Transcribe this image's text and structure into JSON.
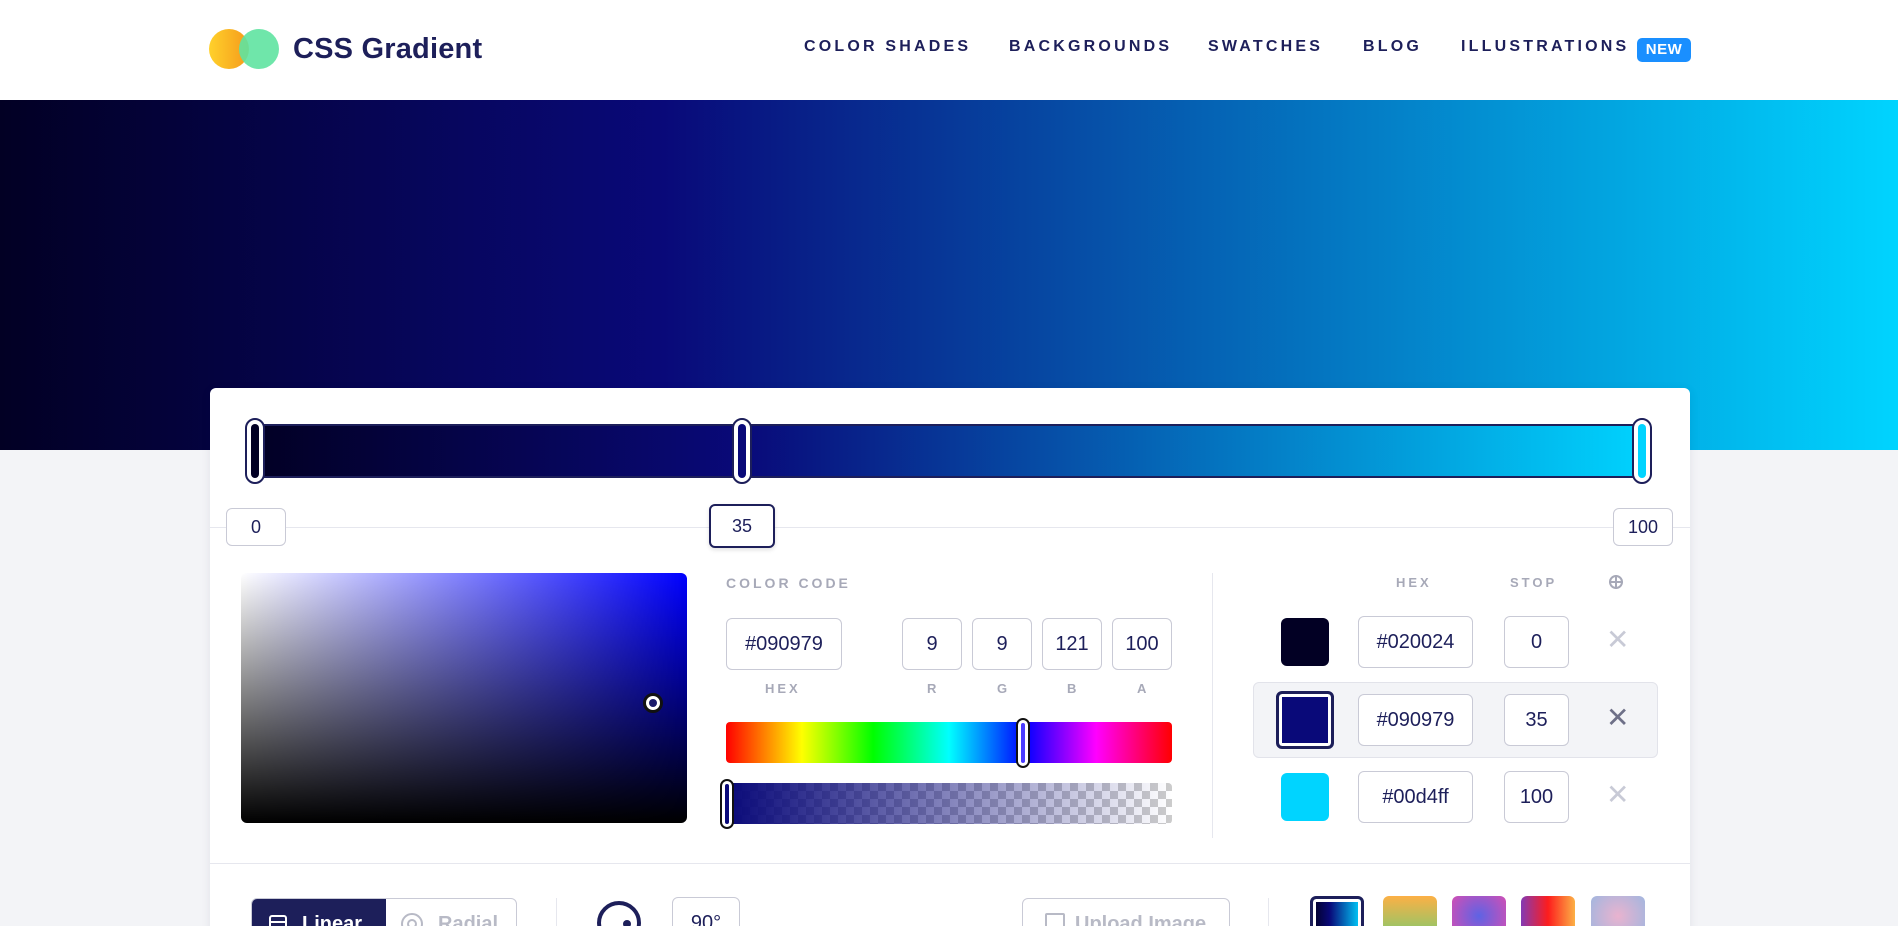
{
  "brand": {
    "name": "CSS Gradient"
  },
  "nav": [
    {
      "label": "COLOR SHADES"
    },
    {
      "label": "BACKGROUNDS"
    },
    {
      "label": "SWATCHES"
    },
    {
      "label": "BLOG"
    },
    {
      "label": "ILLUSTRATIONS",
      "badge": "NEW"
    }
  ],
  "stops_positions": [
    "0",
    "35",
    "100"
  ],
  "color_code": {
    "title": "COLOR CODE",
    "hex": "#090979",
    "r": "9",
    "g": "9",
    "b": "121",
    "a": "100",
    "labels": {
      "hex": "HEX",
      "r": "R",
      "g": "G",
      "b": "B",
      "a": "A"
    }
  },
  "stops_table": {
    "headers": {
      "hex": "HEX",
      "stop": "STOP"
    },
    "rows": [
      {
        "color": "#020024",
        "hex": "#020024",
        "stop": "0",
        "active": false
      },
      {
        "color": "#090979",
        "hex": "#090979",
        "stop": "35",
        "active": true
      },
      {
        "color": "#00d4ff",
        "hex": "#00d4ff",
        "stop": "100",
        "active": false
      }
    ],
    "remove_symbol": "✕"
  },
  "controls": {
    "linear_label": "Linear",
    "radial_label": "Radial",
    "angle": "90°",
    "upload_label": "Upload Image"
  },
  "presets": [
    {
      "colors": [
        "#020024",
        "#090979",
        "#00d4ff"
      ],
      "active": true
    },
    {
      "colors": [
        "#fcb045",
        "#83c96e"
      ],
      "active": false
    },
    {
      "colors": [
        "#d14fb5",
        "#5e63e4"
      ],
      "active": false
    },
    {
      "colors": [
        "#833ab4",
        "#fd1d1d",
        "#fcb045"
      ],
      "active": false
    },
    {
      "colors": [
        "#a2b6df",
        "#e9b3cf"
      ],
      "active": false
    }
  ],
  "colors": {
    "primary": "#1d1f5a",
    "badge": "#1a8fff",
    "muted": "#a7a9b8"
  }
}
